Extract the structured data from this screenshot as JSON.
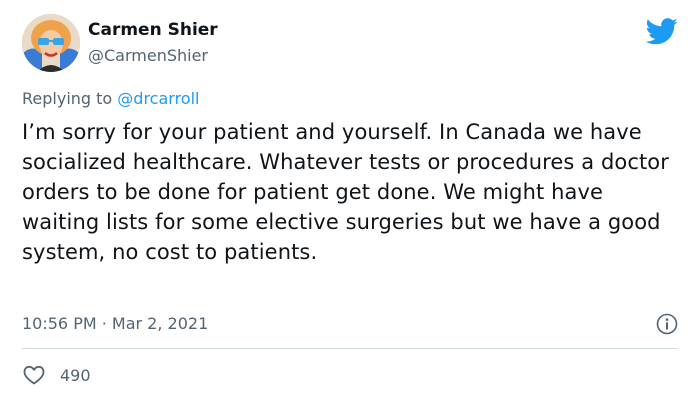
{
  "author": {
    "display_name": "Carmen Shier",
    "handle": "@CarmenShier"
  },
  "reply": {
    "prefix": "Replying to ",
    "mention": "@drcarroll"
  },
  "tweet": {
    "text": "I’m sorry for your patient and yourself.  In Canada we have socialized healthcare. Whatever tests or procedures a doctor orders to be done for patient get done. We might have waiting lists for some elective surgeries but we have a good system, no cost to patients.",
    "timestamp": "10:56 PM · Mar 2, 2021"
  },
  "engagement": {
    "likes": "490"
  },
  "icons": {
    "brand": "twitter-bird-icon",
    "info": "info-icon",
    "like": "heart-icon"
  },
  "colors": {
    "brand_blue": "#1d9bf0",
    "secondary_text": "#536471",
    "primary_text": "#0f1419",
    "divider": "#cfd9de"
  }
}
